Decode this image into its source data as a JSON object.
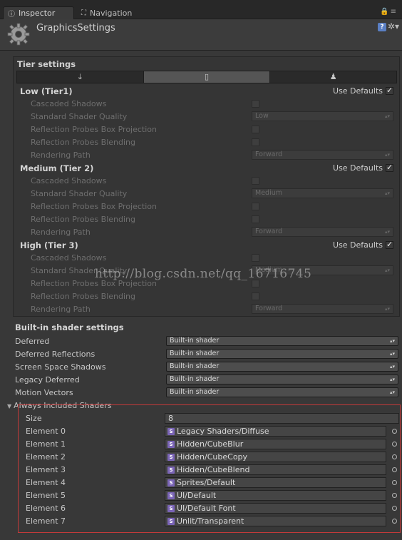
{
  "tabs": [
    {
      "label": "Inspector",
      "icon": "info-icon"
    },
    {
      "label": "Navigation",
      "icon": "navigation-icon"
    }
  ],
  "header": {
    "title": "GraphicsSettings",
    "help_glyph": "?",
    "settings_glyph": "✲▾"
  },
  "tier_settings": {
    "title": "Tier settings",
    "platforms": [
      {
        "icon": "download-icon",
        "glyph": "⤓"
      },
      {
        "icon": "mobile-icon",
        "glyph": "▯"
      },
      {
        "icon": "android-icon",
        "glyph": "♟"
      }
    ],
    "use_defaults_label": "Use Defaults",
    "tiers": [
      {
        "name": "Low (Tier1)",
        "use_defaults": true,
        "cascaded_shadows_label": "Cascaded Shadows",
        "shader_quality_label": "Standard Shader Quality",
        "shader_quality": "Low",
        "box_projection_label": "Reflection Probes Box Projection",
        "blending_label": "Reflection Probes Blending",
        "rendering_path_label": "Rendering Path",
        "rendering_path": "Forward"
      },
      {
        "name": "Medium (Tier 2)",
        "use_defaults": true,
        "cascaded_shadows_label": "Cascaded Shadows",
        "shader_quality_label": "Standard Shader Quality",
        "shader_quality": "Medium",
        "box_projection_label": "Reflection Probes Box Projection",
        "blending_label": "Reflection Probes Blending",
        "rendering_path_label": "Rendering Path",
        "rendering_path": "Forward"
      },
      {
        "name": "High (Tier 3)",
        "use_defaults": true,
        "cascaded_shadows_label": "Cascaded Shadows",
        "shader_quality_label": "Standard Shader Quality",
        "shader_quality": "Medium",
        "box_projection_label": "Reflection Probes Box Projection",
        "blending_label": "Reflection Probes Blending",
        "rendering_path_label": "Rendering Path",
        "rendering_path": "Forward"
      }
    ]
  },
  "builtin": {
    "title": "Built-in shader settings",
    "rows": [
      {
        "label": "Deferred",
        "value": "Built-in shader"
      },
      {
        "label": "Deferred Reflections",
        "value": "Built-in shader"
      },
      {
        "label": "Screen Space Shadows",
        "value": "Built-in shader"
      },
      {
        "label": "Legacy Deferred",
        "value": "Built-in shader"
      },
      {
        "label": "Motion Vectors",
        "value": "Built-in shader"
      }
    ]
  },
  "always_included": {
    "label": "Always Included Shaders",
    "size_label": "Size",
    "size": "8",
    "elements": [
      {
        "label": "Element 0",
        "value": "Legacy Shaders/Diffuse"
      },
      {
        "label": "Element 1",
        "value": "Hidden/CubeBlur"
      },
      {
        "label": "Element 2",
        "value": "Hidden/CubeCopy"
      },
      {
        "label": "Element 3",
        "value": "Hidden/CubeBlend"
      },
      {
        "label": "Element 4",
        "value": "Sprites/Default"
      },
      {
        "label": "Element 5",
        "value": "UI/Default"
      },
      {
        "label": "Element 6",
        "value": "UI/Default Font"
      },
      {
        "label": "Element 7",
        "value": "Unlit/Transparent"
      }
    ]
  },
  "watermark": "http://blog.csdn.net/qq_16716745",
  "colors": {
    "background": "#383838",
    "highlight_box": "#c23a3a",
    "shader_icon": "#7a64b6"
  }
}
